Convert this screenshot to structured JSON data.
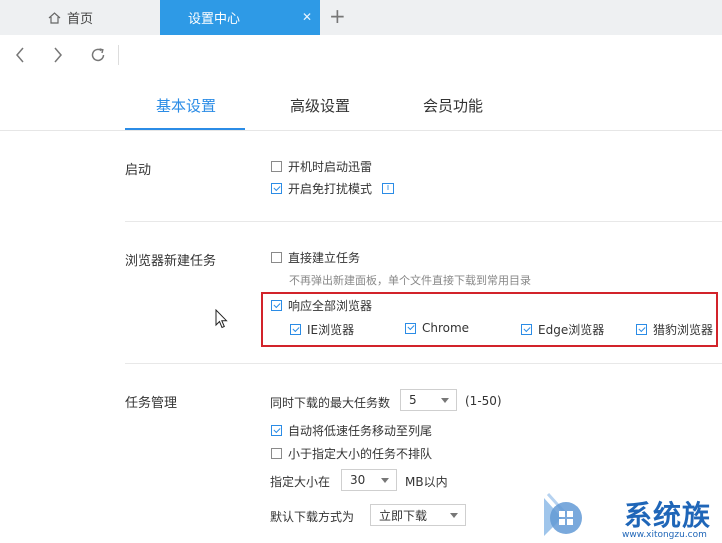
{
  "tabs": {
    "home": "首页",
    "settings": "设置中心",
    "close": "✕",
    "new": "+"
  },
  "settings_tabs": {
    "basic": "基本设置",
    "advanced": "高级设置",
    "member": "会员功能"
  },
  "startup": {
    "label": "启动",
    "boot_start": {
      "label": "开机时启动迅雷",
      "checked": false
    },
    "dnd_mode": {
      "label": "开启免打扰模式",
      "checked": true
    }
  },
  "browser_task": {
    "label": "浏览器新建任务",
    "direct_create": {
      "label": "直接建立任务",
      "checked": false
    },
    "direct_hint": "不再弹出新建面板，单个文件直接下载到常用目录",
    "respond_all": {
      "label": "响应全部浏览器",
      "checked": true
    },
    "browsers": [
      {
        "label": "IE浏览器",
        "checked": true
      },
      {
        "label": "Chrome",
        "checked": true
      },
      {
        "label": "Edge浏览器",
        "checked": true
      },
      {
        "label": "猎豹浏览器",
        "checked": true
      }
    ]
  },
  "task_mgmt": {
    "label": "任务管理",
    "max_tasks_label": "同时下载的最大任务数",
    "max_tasks_value": "5",
    "max_tasks_range": "(1-50)",
    "move_slow": {
      "label": "自动将低速任务移动至列尾",
      "checked": true
    },
    "no_queue_small": {
      "label": "小于指定大小的任务不排队",
      "checked": false
    },
    "size_label": "指定大小在",
    "size_value": "30",
    "size_unit": "MB以内",
    "default_mode_label": "默认下载方式为",
    "default_mode_value": "立即下载"
  },
  "watermark": {
    "text": "系统族",
    "url": "www.xitongzu.com"
  },
  "colors": {
    "accent": "#2b8ce6",
    "tab_active": "#2e9ae6",
    "highlight": "#d2232a"
  }
}
